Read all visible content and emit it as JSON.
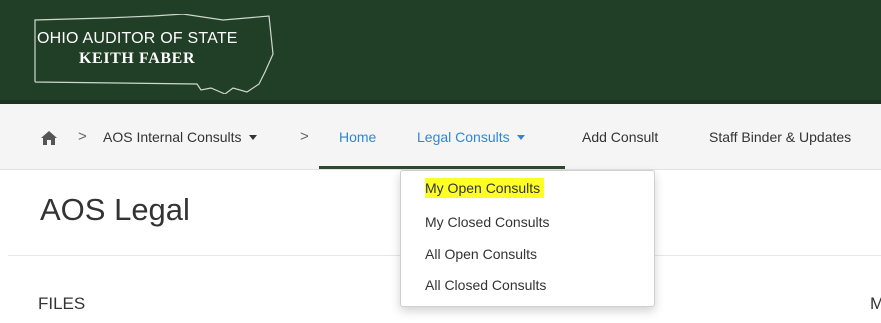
{
  "header": {
    "logo_line1": "OHIO AUDITOR OF STATE",
    "logo_line2": "KEITH FABER",
    "background_color": "#213f26"
  },
  "navbar": {
    "home_icon": "home-icon",
    "breadcrumb_site": "AOS Internal Consults",
    "items": [
      {
        "label": "Home",
        "color": "#2f87d4"
      },
      {
        "label": "Legal Consults",
        "color": "#2f87d4"
      },
      {
        "label": "Add Consult"
      },
      {
        "label": "Staff Binder & Updates"
      }
    ]
  },
  "dropdown": {
    "items": [
      {
        "label": "My Open Consults",
        "highlighted": true,
        "highlight_color": "#ffff28"
      },
      {
        "label": "My Closed Consults"
      },
      {
        "label": "All Open Consults"
      },
      {
        "label": "All Closed Consults"
      }
    ]
  },
  "main": {
    "title": "AOS Legal",
    "section_label": "FILES",
    "right_cut_text": "M"
  }
}
